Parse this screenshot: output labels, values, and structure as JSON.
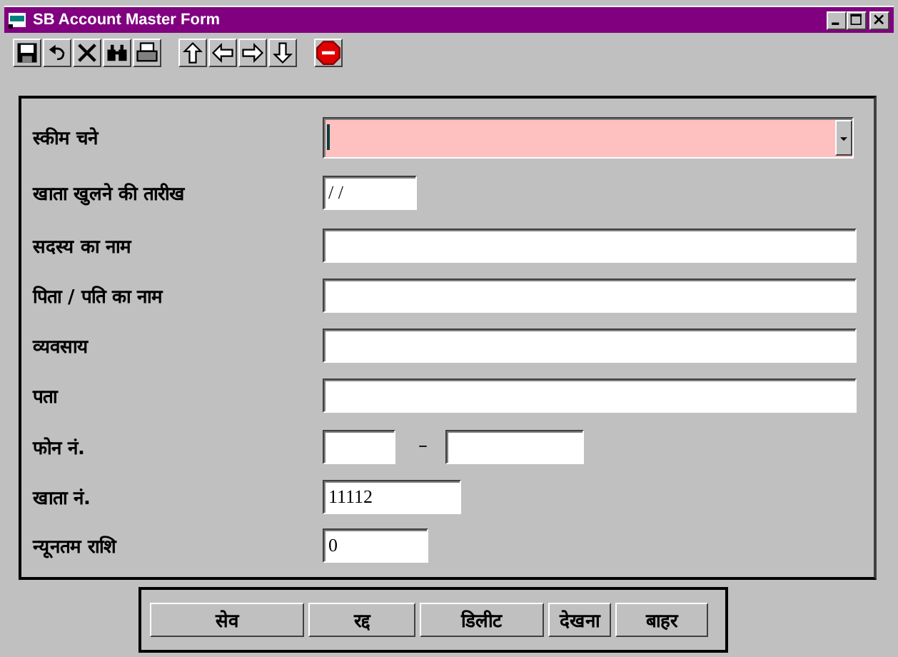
{
  "window": {
    "title": "SB Account Master Form"
  },
  "fields": [
    {
      "label": "स्कीम चने",
      "kind": "combo",
      "focused": true
    },
    {
      "label": "खाता खुलने की तारीख",
      "kind": "date",
      "value": "/ /"
    },
    {
      "label": "सदस्य का नाम",
      "kind": "text"
    },
    {
      "label": "पिता / पति का नाम",
      "kind": "text"
    },
    {
      "label": "व्यवसाय",
      "kind": "text"
    },
    {
      "label": "पता",
      "kind": "text"
    },
    {
      "label": "फोन नं.",
      "kind": "phone",
      "separator": "–"
    },
    {
      "label": "खाता नं.",
      "kind": "number",
      "value": "11112"
    },
    {
      "label": "न्यूनतम राशि",
      "kind": "amount",
      "value": "0"
    }
  ],
  "buttons": [
    "सेव",
    "रद्द",
    "डिलीट",
    "देखना",
    "बाहर"
  ]
}
